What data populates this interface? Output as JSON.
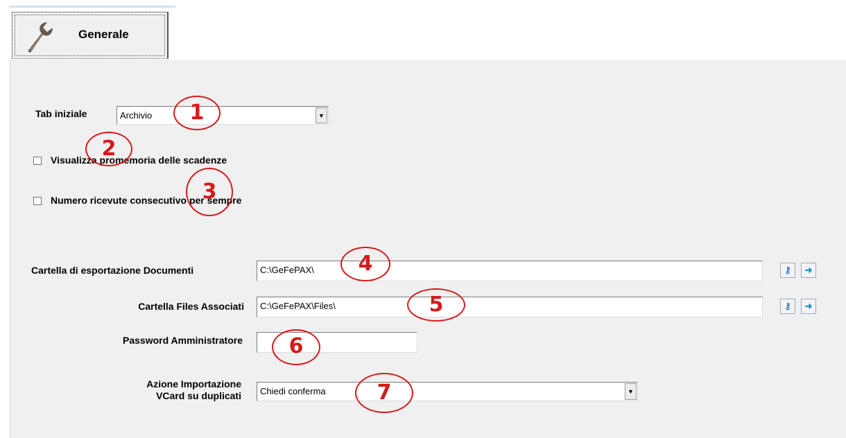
{
  "tab": {
    "label": "Generale"
  },
  "form": {
    "tab_iniziale_label": "Tab iniziale",
    "tab_iniziale_value": "Archivio",
    "promemoria_label": "Visualizza promemoria delle scadenze",
    "numero_ricevute_label": "Numero ricevute consecutivo per sempre",
    "cartella_esportazione_label": "Cartella di esportazione Documenti",
    "cartella_esportazione_value": "C:\\GeFePAX\\",
    "cartella_files_label": "Cartella Files Associati",
    "cartella_files_value": "C:\\GeFePAX\\Files\\",
    "password_label": "Password Amministratore",
    "password_value": "",
    "azione_label_line1": "Azione Importazione",
    "azione_label_line2": "VCard su duplicati",
    "azione_value": "Chiedi conferma"
  },
  "checkboxes": {
    "promemoria_checked": false,
    "numero_ricevute_checked": false
  },
  "icons": {
    "tab": "wrench-icon",
    "browse": "key-icon",
    "open": "arrow-right-icon",
    "dropdown": "chevron-down-icon"
  },
  "callouts": [
    "1",
    "2",
    "3",
    "4",
    "5",
    "6",
    "7"
  ],
  "colors": {
    "callout": "#d61a1a",
    "panel": "#f0f0f0"
  }
}
